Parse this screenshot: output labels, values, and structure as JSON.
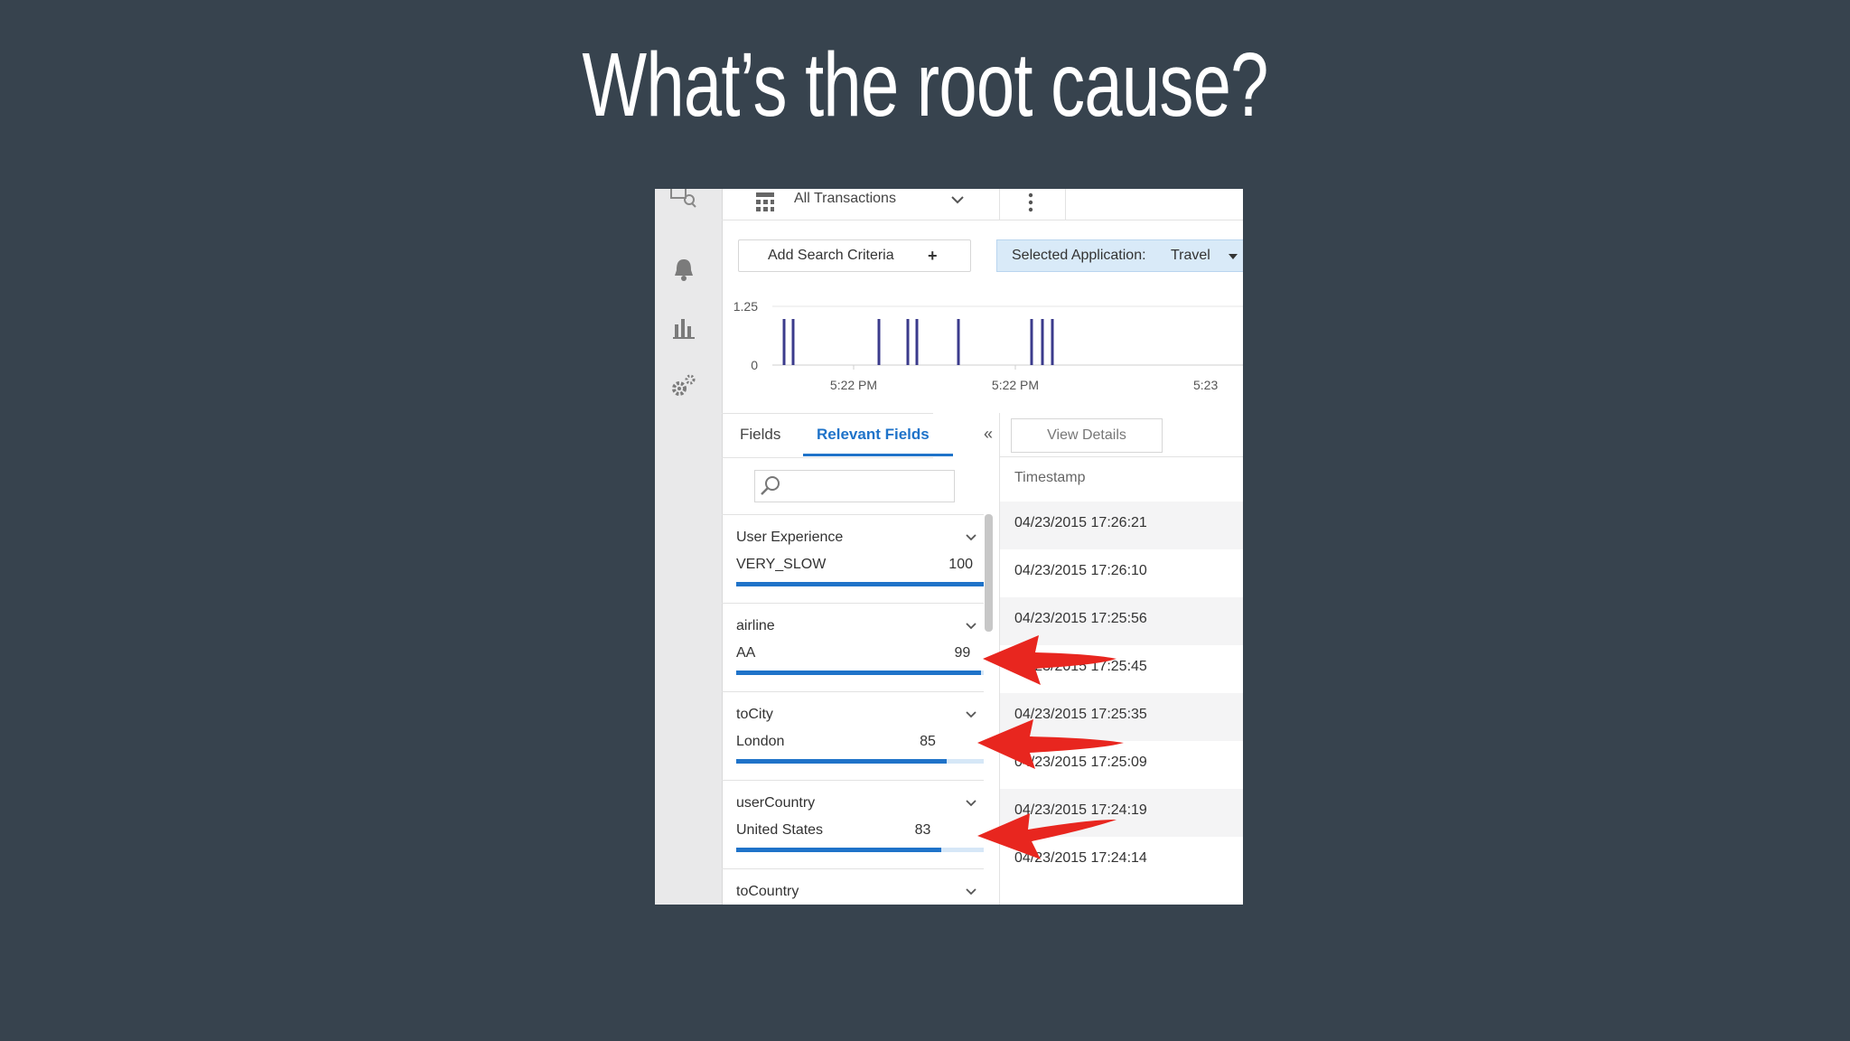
{
  "slide": {
    "title": "What’s the root cause?"
  },
  "rail": {
    "icons": [
      "search-icon",
      "bell-icon",
      "bar-chart-icon",
      "gears-icon"
    ]
  },
  "topbar": {
    "view_label": "All Transactions"
  },
  "search_bar": {
    "add_criteria_label": "Add Search Criteria",
    "add_criteria_plus": "+",
    "app_label": "Selected Application:",
    "app_value": "Travel"
  },
  "chart_data": {
    "type": "bar",
    "y_ticks": [
      "1.25",
      "0"
    ],
    "x_ticks": [
      "5:22 PM",
      "5:22 PM",
      "5:23"
    ],
    "event_count": 10,
    "color": "#3b3b8c"
  },
  "fields_panel": {
    "tabs": [
      {
        "label": "Fields"
      },
      {
        "label": "Relevant Fields"
      }
    ],
    "collapse_glyph": "«",
    "items": [
      {
        "name": "User Experience",
        "top_value": "VERY_SLOW",
        "count": "100",
        "fill": 1.0
      },
      {
        "name": "airline",
        "top_value": "AA",
        "count": "99",
        "fill": 0.99
      },
      {
        "name": "toCity",
        "top_value": "London",
        "count": "85",
        "fill": 0.85
      },
      {
        "name": "userCountry",
        "top_value": "United States",
        "count": "83",
        "fill": 0.83
      },
      {
        "name": "toCountry",
        "top_value": "",
        "count": "",
        "fill": 0
      }
    ]
  },
  "table": {
    "view_details_label": "View Details",
    "column_header": "Timestamp",
    "rows": [
      "04/23/2015 17:26:21",
      "04/23/2015 17:26:10",
      "04/23/2015 17:25:56",
      "04/23/2015 17:25:45",
      "04/23/2015 17:25:35",
      "04/23/2015 17:25:09",
      "04/23/2015 17:24:19",
      "04/23/2015 17:24:14"
    ]
  },
  "annotations": {
    "arrow_color": "#e8261f"
  }
}
